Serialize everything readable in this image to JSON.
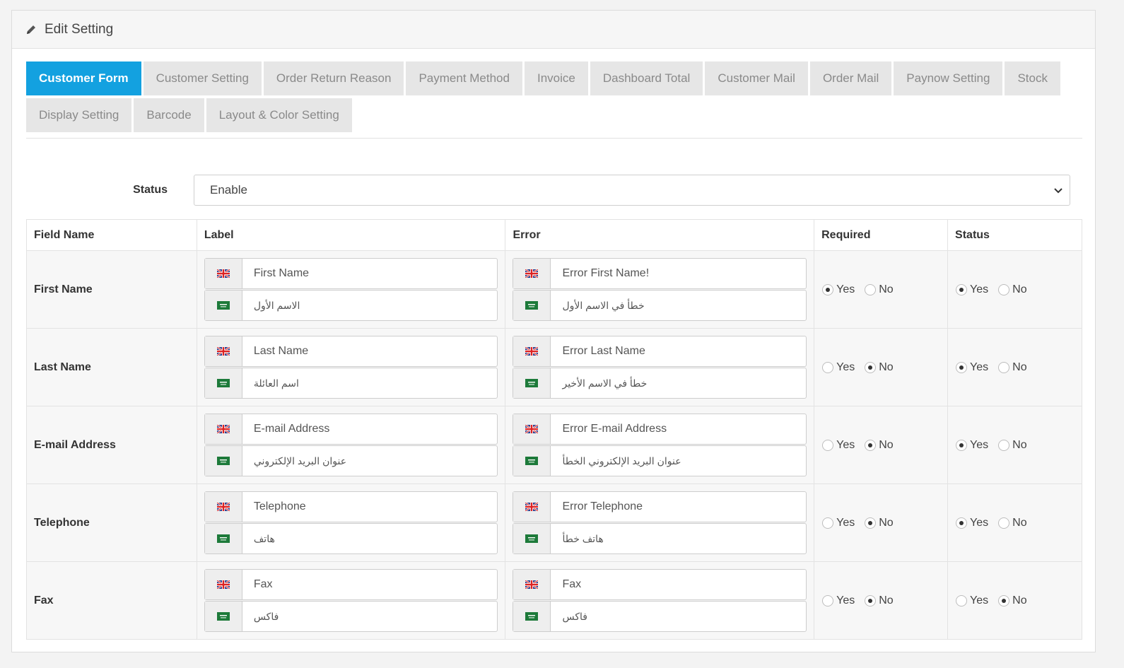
{
  "header": {
    "title": "Edit Setting",
    "icon": "pencil-icon"
  },
  "tabs": [
    {
      "label": "Customer Form",
      "active": true
    },
    {
      "label": "Customer Setting",
      "active": false
    },
    {
      "label": "Order Return Reason",
      "active": false
    },
    {
      "label": "Payment Method",
      "active": false
    },
    {
      "label": "Invoice",
      "active": false
    },
    {
      "label": "Dashboard Total",
      "active": false
    },
    {
      "label": "Customer Mail",
      "active": false
    },
    {
      "label": "Order Mail",
      "active": false
    },
    {
      "label": "Paynow Setting",
      "active": false
    },
    {
      "label": "Stock",
      "active": false
    },
    {
      "label": "Display Setting",
      "active": false
    },
    {
      "label": "Barcode",
      "active": false
    },
    {
      "label": "Layout & Color Setting",
      "active": false
    }
  ],
  "status": {
    "label": "Status",
    "value": "Enable"
  },
  "table": {
    "headers": [
      "Field Name",
      "Label",
      "Error",
      "Required",
      "Status"
    ],
    "radio_labels": {
      "yes": "Yes",
      "no": "No"
    },
    "rows": [
      {
        "name": "First Name",
        "label_en": "First Name",
        "label_ar": "الاسم الأول",
        "error_en": "Error First Name!",
        "error_ar": "خطأ في الاسم الأول",
        "required": "yes",
        "status": "yes"
      },
      {
        "name": "Last Name",
        "label_en": "Last Name",
        "label_ar": "اسم العائلة",
        "error_en": "Error Last Name",
        "error_ar": "خطأ في الاسم الأخير",
        "required": "no",
        "status": "yes"
      },
      {
        "name": "E-mail Address",
        "label_en": "E-mail Address",
        "label_ar": "عنوان البريد الإلكتروني",
        "error_en": "Error E-mail Address",
        "error_ar": "عنوان البريد الإلكتروني الخطأ",
        "required": "no",
        "status": "yes"
      },
      {
        "name": "Telephone",
        "label_en": "Telephone",
        "label_ar": "هاتف",
        "error_en": "Error Telephone",
        "error_ar": "هاتف خطأ",
        "required": "no",
        "status": "yes"
      },
      {
        "name": "Fax",
        "label_en": "Fax",
        "label_ar": "فاكس",
        "error_en": "Fax",
        "error_ar": "فاكس",
        "required": "no",
        "status": "no"
      }
    ]
  },
  "icons": {
    "english": "uk-flag-icon",
    "arabic": "saudi-flag-icon"
  },
  "colors": {
    "active_tab": "#13a1e0",
    "tab_bg": "#e6e6e6"
  }
}
